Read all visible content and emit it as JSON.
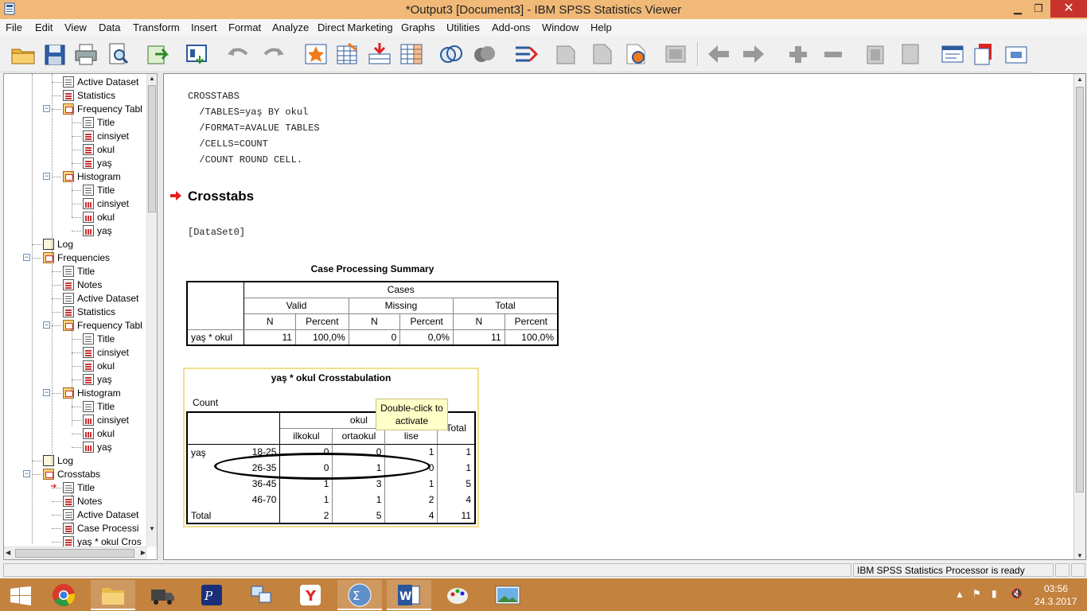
{
  "window": {
    "title": "*Output3 [Document3] - IBM SPSS Statistics Viewer",
    "minimize": "▁",
    "maximize": "❐",
    "close": "✕"
  },
  "menu": [
    "File",
    "Edit",
    "View",
    "Data",
    "Transform",
    "Insert",
    "Format",
    "Analyze",
    "Direct Marketing",
    "Graphs",
    "Utilities",
    "Add-ons",
    "Window",
    "Help"
  ],
  "toolbar_icons": [
    "open-icon",
    "save-icon",
    "print-icon",
    "print-preview-icon",
    "export-icon",
    "recall-dialog-icon",
    "undo-icon",
    "redo-icon",
    "goto-case-icon",
    "goto-variable-icon",
    "insert-cases-icon",
    "variables-icon",
    "select-cases-icon",
    "weight-cases-icon",
    "split-file-icon",
    "chart-builder-icon",
    "pivot-icon",
    "show-all-icon",
    "hide-icon",
    "designate-window-icon",
    "back-icon",
    "forward-icon",
    "expand-icon",
    "collapse-icon",
    "show-icon",
    "hide-all-icon",
    "heading-icon",
    "title-icon",
    "text-icon",
    "image-icon"
  ],
  "tree": [
    {
      "label": "Active Dataset",
      "level": 2,
      "icon": "doc"
    },
    {
      "label": "Statistics",
      "level": 2,
      "icon": "tbl"
    },
    {
      "label": "Frequency Tabl",
      "level": 2,
      "icon": "folder"
    },
    {
      "label": "Title",
      "level": 3,
      "icon": "doc"
    },
    {
      "label": "cinsiyet",
      "level": 3,
      "icon": "tbl"
    },
    {
      "label": "okul",
      "level": 3,
      "icon": "tbl"
    },
    {
      "label": "yaş",
      "level": 3,
      "icon": "tbl"
    },
    {
      "label": "Histogram",
      "level": 2,
      "icon": "folder"
    },
    {
      "label": "Title",
      "level": 3,
      "icon": "doc"
    },
    {
      "label": "cinsiyet",
      "level": 3,
      "icon": "chart"
    },
    {
      "label": "okul",
      "level": 3,
      "icon": "chart"
    },
    {
      "label": "yaş",
      "level": 3,
      "icon": "chart"
    },
    {
      "label": "Log",
      "level": 1,
      "icon": "book"
    },
    {
      "label": "Frequencies",
      "level": 1,
      "icon": "folder"
    },
    {
      "label": "Title",
      "level": 2,
      "icon": "doc"
    },
    {
      "label": "Notes",
      "level": 2,
      "icon": "tbl"
    },
    {
      "label": "Active Dataset",
      "level": 2,
      "icon": "doc"
    },
    {
      "label": "Statistics",
      "level": 2,
      "icon": "tbl"
    },
    {
      "label": "Frequency Tabl",
      "level": 2,
      "icon": "folder"
    },
    {
      "label": "Title",
      "level": 3,
      "icon": "doc"
    },
    {
      "label": "cinsiyet",
      "level": 3,
      "icon": "tbl"
    },
    {
      "label": "okul",
      "level": 3,
      "icon": "tbl"
    },
    {
      "label": "yaş",
      "level": 3,
      "icon": "tbl"
    },
    {
      "label": "Histogram",
      "level": 2,
      "icon": "folder"
    },
    {
      "label": "Title",
      "level": 3,
      "icon": "doc"
    },
    {
      "label": "cinsiyet",
      "level": 3,
      "icon": "chart"
    },
    {
      "label": "okul",
      "level": 3,
      "icon": "chart"
    },
    {
      "label": "yaş",
      "level": 3,
      "icon": "chart"
    },
    {
      "label": "Log",
      "level": 1,
      "icon": "book"
    },
    {
      "label": "Crosstabs",
      "level": 1,
      "icon": "folder"
    },
    {
      "label": "Title",
      "level": 2,
      "icon": "doc",
      "current": true
    },
    {
      "label": "Notes",
      "level": 2,
      "icon": "tbl"
    },
    {
      "label": "Active Dataset",
      "level": 2,
      "icon": "doc"
    },
    {
      "label": "Case Processi",
      "level": 2,
      "icon": "tbl"
    },
    {
      "label": "yaş * okul Cros",
      "level": 2,
      "icon": "tbl"
    }
  ],
  "output": {
    "syntax": [
      "CROSSTABS",
      "  /TABLES=yaş BY okul",
      "  /FORMAT=AVALUE TABLES",
      "  /CELLS=COUNT",
      "  /COUNT ROUND CELL."
    ],
    "heading": "Crosstabs",
    "dataset": "[DataSet0]",
    "case_summary": {
      "title": "Case Processing Summary",
      "cases_label": "Cases",
      "groups": [
        "Valid",
        "Missing",
        "Total"
      ],
      "subheaders": [
        "N",
        "Percent",
        "N",
        "Percent",
        "N",
        "Percent"
      ],
      "row_label": "yaş * okul",
      "values": [
        "11",
        "100,0%",
        "0",
        "0,0%",
        "11",
        "100,0%"
      ]
    },
    "crosstab": {
      "title": "yaş * okul Crosstabulation",
      "count_label": "Count",
      "col_var": "okul",
      "columns": [
        "ilkokul",
        "ortaokul",
        "lise",
        "Total"
      ],
      "row_var": "yaş",
      "rows": [
        {
          "label": "18-25",
          "values": [
            "0",
            "0",
            "1",
            "1"
          ]
        },
        {
          "label": "26-35",
          "values": [
            "0",
            "1",
            "0",
            "1"
          ]
        },
        {
          "label": "36-45",
          "values": [
            "1",
            "3",
            "1",
            "5"
          ]
        },
        {
          "label": "46-70",
          "values": [
            "1",
            "1",
            "2",
            "4"
          ]
        }
      ],
      "total": {
        "label": "Total",
        "values": [
          "2",
          "5",
          "4",
          "11"
        ]
      },
      "tooltip": "Double-click to activate"
    }
  },
  "status": "IBM SPSS Statistics Processor is ready",
  "taskbar": [
    "start-icon",
    "chrome-icon",
    "file-explorer-icon",
    "truck-app-icon",
    "pb-app-icon",
    "network-app-icon",
    "yandex-icon",
    "spss-icon",
    "word-icon",
    "paint-icon",
    "photo-viewer-icon"
  ],
  "clock": {
    "time": "03:56",
    "date": "24.3.2017"
  }
}
